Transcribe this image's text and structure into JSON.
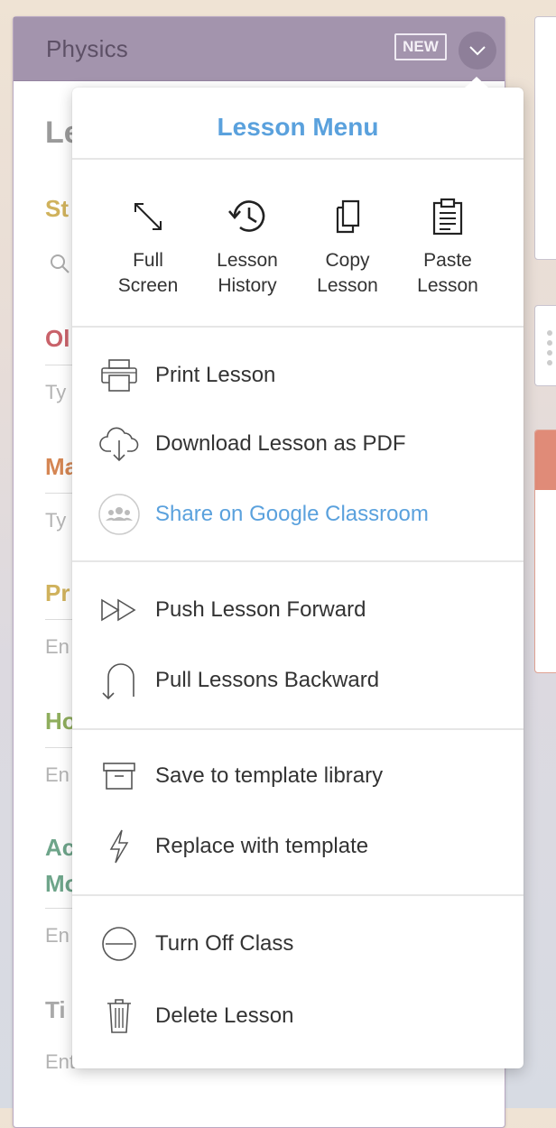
{
  "card": {
    "title": "Physics",
    "badge": "NEW"
  },
  "background_peek": [
    "Le",
    "St",
    "Ol",
    "Ty",
    "Ma",
    "Ty",
    "Pr",
    "En",
    "Ho",
    "En",
    "Ac",
    "Mo",
    "En",
    "Ti",
    "Enter some text"
  ],
  "menu": {
    "title": "Lesson Menu",
    "tools": [
      {
        "line1": "Full",
        "line2": "Screen",
        "icon": "expand-icon"
      },
      {
        "line1": "Lesson",
        "line2": "History",
        "icon": "history-icon"
      },
      {
        "line1": "Copy",
        "line2": "Lesson",
        "icon": "copy-icon"
      },
      {
        "line1": "Paste",
        "line2": "Lesson",
        "icon": "clipboard-icon"
      }
    ],
    "items": {
      "print": "Print Lesson",
      "download_pdf": "Download Lesson as PDF",
      "share_classroom": "Share on Google Classroom",
      "push_forward": "Push Lesson Forward",
      "pull_backward": "Pull Lessons Backward",
      "save_template": "Save to template library",
      "replace_template": "Replace with template",
      "turn_off_class": "Turn Off Class",
      "delete_lesson": "Delete Lesson"
    }
  },
  "colors": {
    "accent": "#5aa1dd",
    "header": "#a394ad"
  }
}
